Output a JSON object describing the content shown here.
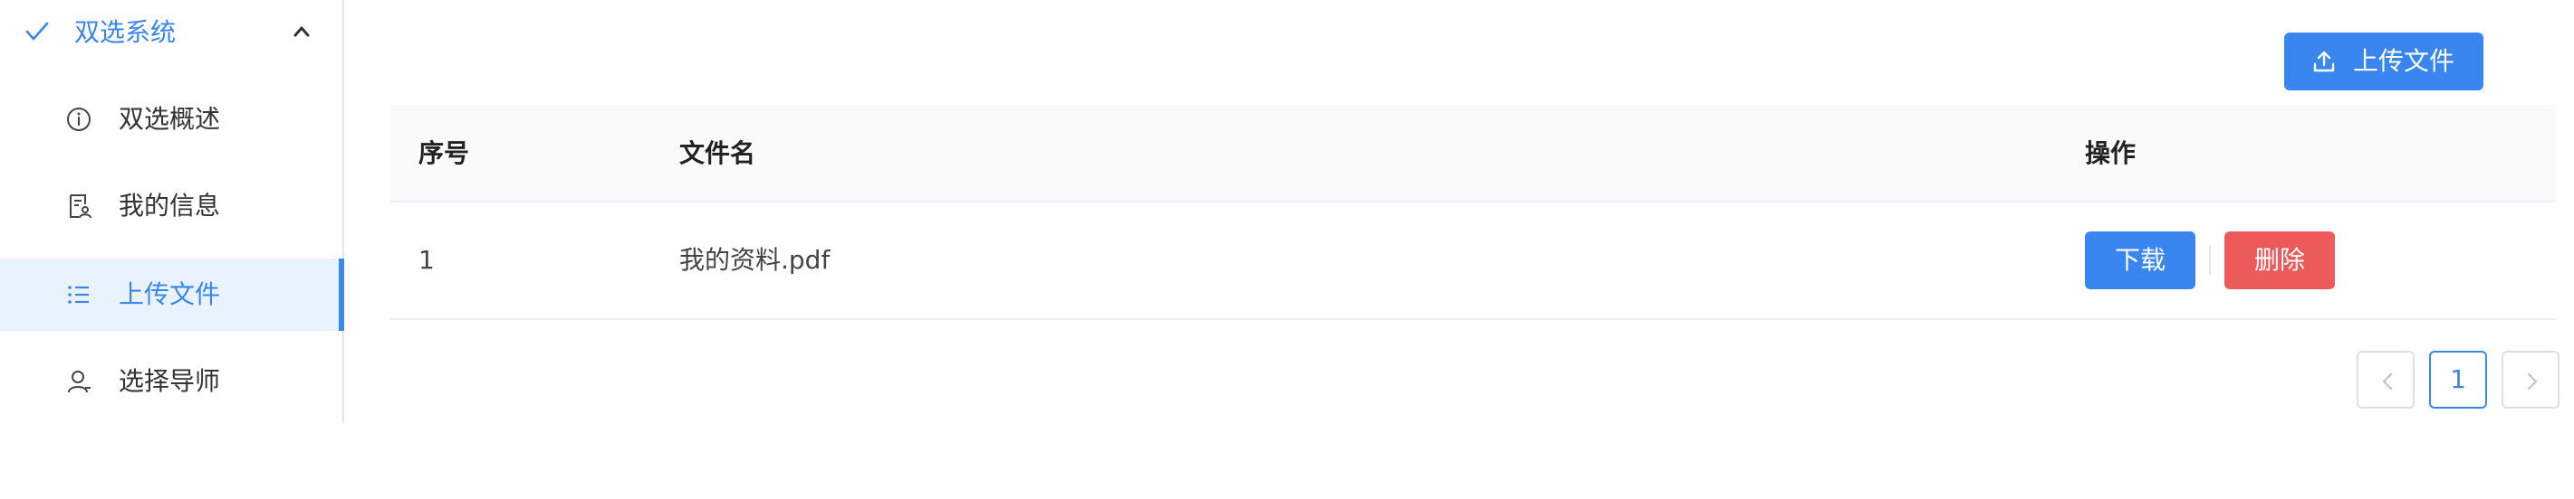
{
  "sidebar": {
    "header": {
      "title": "双选系统",
      "icon": "check-icon",
      "toggle_icon": "chevron-up-icon"
    },
    "items": [
      {
        "label": "双选概述",
        "icon": "info-circle-icon",
        "active": false
      },
      {
        "label": "我的信息",
        "icon": "user-document-icon",
        "active": false
      },
      {
        "label": "上传文件",
        "icon": "list-icon",
        "active": true
      },
      {
        "label": "选择导师",
        "icon": "user-icon",
        "active": false
      }
    ]
  },
  "toolbar": {
    "upload_label": "上传文件",
    "upload_icon": "upload-icon"
  },
  "table": {
    "columns": [
      "序号",
      "文件名",
      "操作"
    ],
    "rows": [
      {
        "index": "1",
        "filename": "我的资料.pdf",
        "download_label": "下载",
        "delete_label": "删除"
      }
    ]
  },
  "pagination": {
    "current_page": "1",
    "prev_icon": "chevron-left-icon",
    "next_icon": "chevron-right-icon"
  },
  "colors": {
    "primary": "#3a86f0",
    "danger": "#ec5a5a",
    "active_bg": "#e8f3ff",
    "header_bg": "#fafafa"
  }
}
